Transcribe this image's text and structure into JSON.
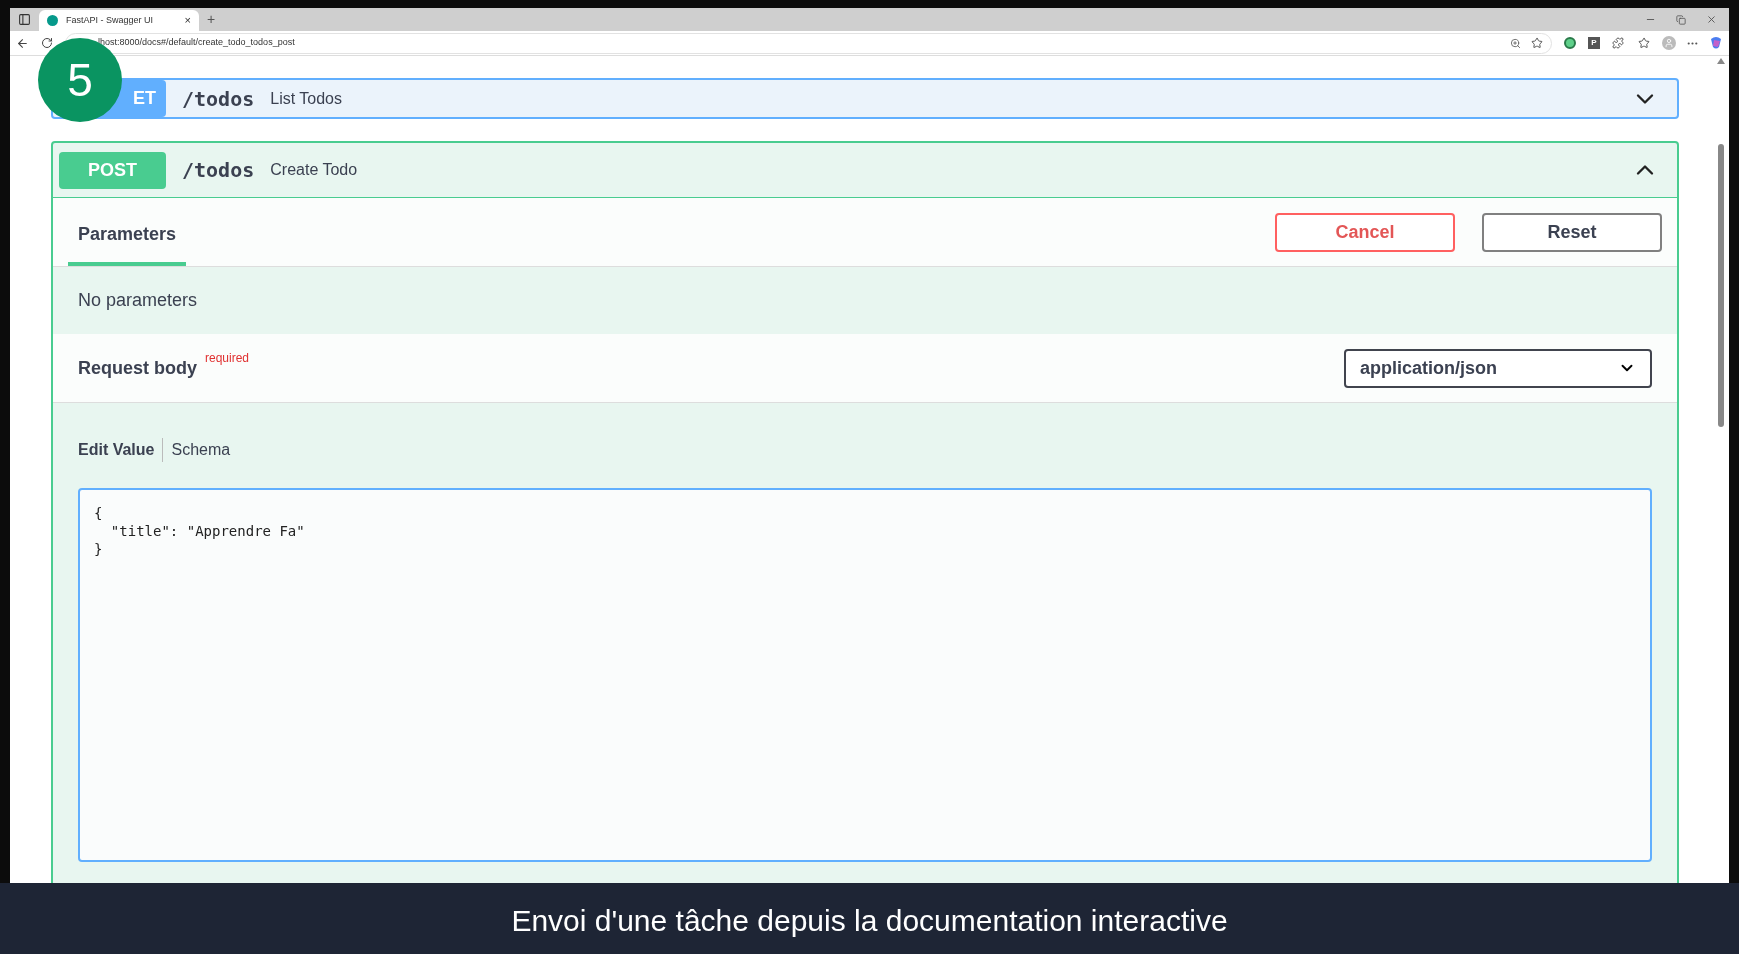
{
  "browser": {
    "tab_title": "FastAPI - Swagger UI",
    "tab_close": "×",
    "new_tab": "+",
    "url": "lhost:8000/docs#/default/create_todo_todos_post",
    "extension_label": "P"
  },
  "step_badge": "5",
  "operations": [
    {
      "kind": "get",
      "method": "ET",
      "path": "/todos",
      "summary": "List Todos",
      "expanded": false
    },
    {
      "kind": "post",
      "method": "POST",
      "path": "/todos",
      "summary": "Create Todo",
      "expanded": true
    }
  ],
  "section_tabs": [
    {
      "label": "Parameters",
      "selected": true
    }
  ],
  "buttons": [
    {
      "kind": "cancel",
      "label": "Cancel"
    },
    {
      "kind": "reset",
      "label": "Reset"
    }
  ],
  "no_parameters": "No parameters",
  "request_body": {
    "label": "Request body",
    "required": "required",
    "content_type": "application/json"
  },
  "editor_tabs": [
    {
      "label": "Edit Value",
      "selected": true
    },
    {
      "label": "Schema",
      "selected": false
    }
  ],
  "body_lines": [
    "{",
    "  \"title\": \"Apprendre Fa\"",
    "}"
  ],
  "caption": "Envoi d'une tâche depuis la documentation interactive"
}
